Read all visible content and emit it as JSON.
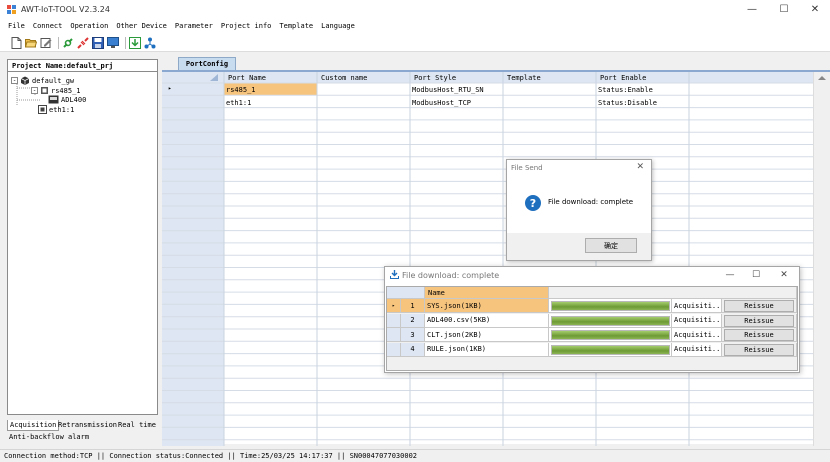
{
  "window": {
    "title": "AWT-IoT-TOOL V2.3.24",
    "minimize": "—",
    "maximize": "☐",
    "close": "✕"
  },
  "menu": [
    "File",
    "Connect",
    "Operation",
    "Other Device",
    "Parameter",
    "Project info",
    "Template",
    "Language"
  ],
  "toolbar_icons": [
    "new-icon",
    "open-icon",
    "edit-icon",
    "connect-icon",
    "disconnect-icon",
    "save-icon",
    "monitor-icon",
    "download-icon",
    "network-icon"
  ],
  "project": {
    "header": "Project Name:default_prj",
    "tree": {
      "root": "default_gw",
      "port1": "rs485_1",
      "device": "ADL400",
      "port2": "eth1:1"
    }
  },
  "left_tabs": [
    "Acquisition",
    "Retransmission",
    "Real time",
    "Anti-backflow alarm"
  ],
  "main_tab": "PortConfig",
  "grid": {
    "columns": [
      "Port Name",
      "Custom name",
      "Port Style",
      "Template",
      "Port Enable"
    ],
    "rows": [
      {
        "port_name": "rs485_1",
        "custom_name": "",
        "port_style": "ModbusHost_RTU_SN",
        "template": "",
        "port_enable": "Status:Enable"
      },
      {
        "port_name": "eth1:1",
        "custom_name": "",
        "port_style": "ModbusHost_TCP",
        "template": "",
        "port_enable": "Status:Disable"
      }
    ],
    "current_row_marker": "▸"
  },
  "file_send_dialog": {
    "title": "File Send",
    "close": "✕",
    "icon": "?",
    "message": "File download: complete",
    "ok_label": "确定"
  },
  "download_window": {
    "title": "File download: complete",
    "minimize": "—",
    "maximize": "☐",
    "close": "✕",
    "name_header": "Name",
    "rows": [
      {
        "no": "1",
        "name": "SYS.json(1KB)",
        "progress": 1.0,
        "status": "Acquisiti...",
        "action": "Reissue"
      },
      {
        "no": "2",
        "name": "ADL400.csv(5KB)",
        "progress": 1.0,
        "status": "Acquisiti...",
        "action": "Reissue"
      },
      {
        "no": "3",
        "name": "CLT.json(2KB)",
        "progress": 1.0,
        "status": "Acquisiti...",
        "action": "Reissue"
      },
      {
        "no": "4",
        "name": "RULE.json(1KB)",
        "progress": 1.0,
        "status": "Acquisiti...",
        "action": "Reissue"
      }
    ]
  },
  "status_bar": "Connection method:TCP || Connection status:Connected || Time:25/03/25 14:17:37 || SN00047077030002",
  "colors": {
    "selected_row": "#f7c47e",
    "header_blue": "#dce7f5",
    "progress_green": "#7cab42",
    "accent_blue": "#1f6fbf"
  }
}
